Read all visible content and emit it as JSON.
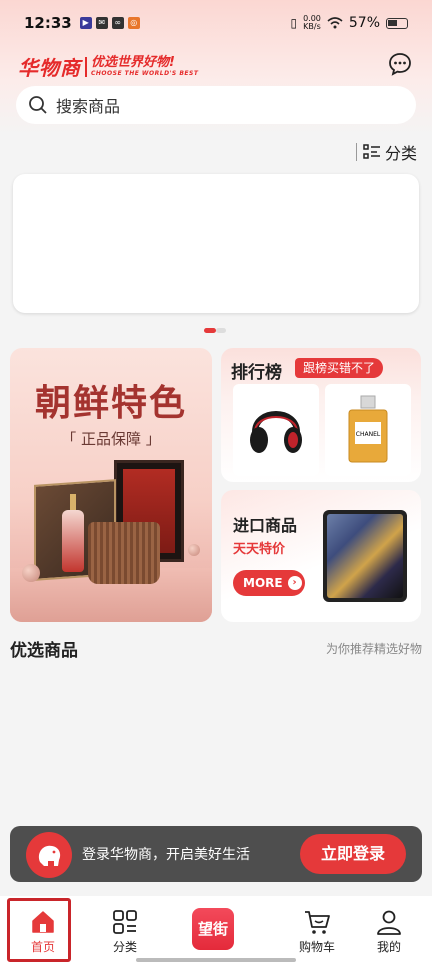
{
  "status_bar": {
    "time": "12:33",
    "net_speed_value": "0.00",
    "net_speed_unit": "KB/s",
    "battery": "57%"
  },
  "header": {
    "logo_main": "华物商",
    "logo_slogan": "优选世界好物!",
    "logo_slogan_en": "CHOOSE THE WORLD'S BEST",
    "message_icon": "chat-bubble-icon"
  },
  "search": {
    "placeholder": "搜索商品"
  },
  "category_link": {
    "label": "分类"
  },
  "promo_left": {
    "title": "朝鲜特色",
    "subtitle": "「 正品保障 」"
  },
  "promo_ranking": {
    "title": "排行榜",
    "tag": "跟榜买错不了",
    "perfume_label": "CHANEL"
  },
  "promo_import": {
    "title": "进口商品",
    "subtitle": "天天特价",
    "more_label": "MORE"
  },
  "section": {
    "title": "优选商品",
    "subtitle": "为你推荐精选好物"
  },
  "login_bar": {
    "text": "登录华物商，开启美好生活",
    "button": "立即登录"
  },
  "bottom_nav": {
    "items": [
      {
        "label": "首页",
        "icon": "home-icon",
        "active": true
      },
      {
        "label": "分类",
        "icon": "grid-icon"
      },
      {
        "label": "望街",
        "icon": "wangjie-logo"
      },
      {
        "label": "购物车",
        "icon": "cart-icon"
      },
      {
        "label": "我的",
        "icon": "person-icon"
      }
    ]
  },
  "colors": {
    "brand_red": "#e5393a",
    "selection_border": "#c9252a"
  }
}
